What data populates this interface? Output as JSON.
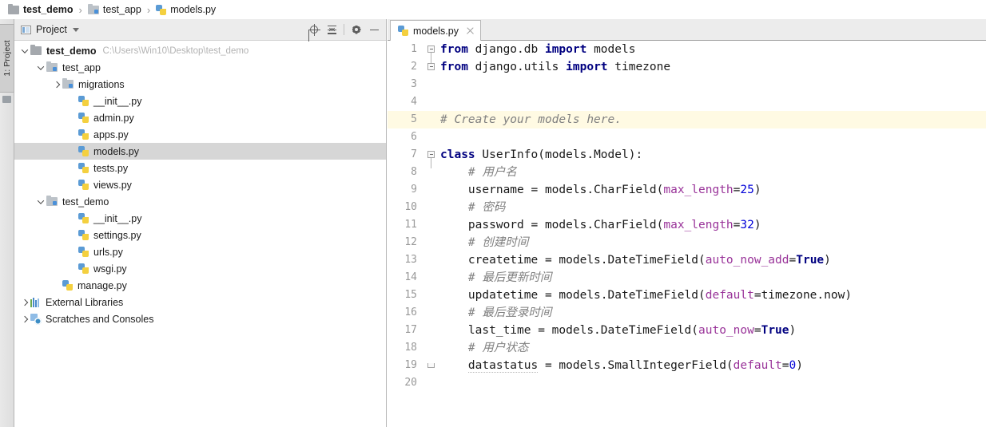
{
  "breadcrumb": {
    "items": [
      {
        "label": "test_demo",
        "icon": "folder-icon",
        "bold": true
      },
      {
        "label": "test_app",
        "icon": "folder-icon",
        "bold": false
      },
      {
        "label": "models.py",
        "icon": "python-file-icon",
        "bold": false
      }
    ],
    "separator": "›"
  },
  "tool_strip": {
    "tab_label": "1: Project"
  },
  "project_panel": {
    "title": "Project",
    "actions": [
      {
        "name": "locate-in-tree-button",
        "icon": "crosshair-icon"
      },
      {
        "name": "collapse-all-button",
        "icon": "collapse-all-icon"
      },
      {
        "name": "panel-settings-button",
        "icon": "gear-icon"
      },
      {
        "name": "hide-panel-button",
        "icon": "minimize-icon"
      }
    ],
    "tree": [
      {
        "label": "test_demo",
        "sub": "C:\\Users\\Win10\\Desktop\\test_demo",
        "icon": "folder-icon",
        "arrow": "down",
        "indent": 0,
        "bold": true,
        "selected": false
      },
      {
        "label": "test_app",
        "sub": "",
        "icon": "folder-blue-icon",
        "arrow": "down",
        "indent": 1,
        "bold": false,
        "selected": false
      },
      {
        "label": "migrations",
        "sub": "",
        "icon": "folder-blue-icon",
        "arrow": "right",
        "indent": 2,
        "bold": false,
        "selected": false
      },
      {
        "label": "__init__.py",
        "sub": "",
        "icon": "python-file-icon",
        "arrow": "none",
        "indent": 3,
        "bold": false,
        "selected": false
      },
      {
        "label": "admin.py",
        "sub": "",
        "icon": "python-file-icon",
        "arrow": "none",
        "indent": 3,
        "bold": false,
        "selected": false
      },
      {
        "label": "apps.py",
        "sub": "",
        "icon": "python-file-icon",
        "arrow": "none",
        "indent": 3,
        "bold": false,
        "selected": false
      },
      {
        "label": "models.py",
        "sub": "",
        "icon": "python-file-icon",
        "arrow": "none",
        "indent": 3,
        "bold": false,
        "selected": true
      },
      {
        "label": "tests.py",
        "sub": "",
        "icon": "python-file-icon",
        "arrow": "none",
        "indent": 3,
        "bold": false,
        "selected": false
      },
      {
        "label": "views.py",
        "sub": "",
        "icon": "python-file-icon",
        "arrow": "none",
        "indent": 3,
        "bold": false,
        "selected": false
      },
      {
        "label": "test_demo",
        "sub": "",
        "icon": "folder-blue-icon",
        "arrow": "down",
        "indent": 1,
        "bold": false,
        "selected": false
      },
      {
        "label": "__init__.py",
        "sub": "",
        "icon": "python-file-icon",
        "arrow": "none",
        "indent": 3,
        "bold": false,
        "selected": false
      },
      {
        "label": "settings.py",
        "sub": "",
        "icon": "python-file-icon",
        "arrow": "none",
        "indent": 3,
        "bold": false,
        "selected": false
      },
      {
        "label": "urls.py",
        "sub": "",
        "icon": "python-file-icon",
        "arrow": "none",
        "indent": 3,
        "bold": false,
        "selected": false
      },
      {
        "label": "wsgi.py",
        "sub": "",
        "icon": "python-file-icon",
        "arrow": "none",
        "indent": 3,
        "bold": false,
        "selected": false
      },
      {
        "label": "manage.py",
        "sub": "",
        "icon": "python-file-icon",
        "arrow": "none",
        "indent": 2,
        "bold": false,
        "selected": false
      },
      {
        "label": "External Libraries",
        "sub": "",
        "icon": "library-icon",
        "arrow": "right",
        "indent": 0,
        "bold": false,
        "selected": false
      },
      {
        "label": "Scratches and Consoles",
        "sub": "",
        "icon": "scratches-icon",
        "arrow": "right",
        "indent": 0,
        "bold": false,
        "selected": false
      }
    ]
  },
  "editor": {
    "tabs": [
      {
        "label": "models.py",
        "icon": "python-file-icon",
        "active": true,
        "close_label": "×"
      }
    ],
    "lines": [
      {
        "num": "1",
        "fold": "start",
        "current": false,
        "tokens": [
          {
            "t": "from ",
            "c": "t-kw"
          },
          {
            "t": "django.db ",
            "c": "t-plain"
          },
          {
            "t": "import ",
            "c": "t-kw"
          },
          {
            "t": "models",
            "c": "t-plain"
          }
        ]
      },
      {
        "num": "2",
        "fold": "end",
        "current": false,
        "tokens": [
          {
            "t": "from ",
            "c": "t-kw"
          },
          {
            "t": "django.utils ",
            "c": "t-plain"
          },
          {
            "t": "import ",
            "c": "t-kw"
          },
          {
            "t": "timezone",
            "c": "t-plain"
          }
        ]
      },
      {
        "num": "3",
        "fold": "none",
        "current": false,
        "tokens": []
      },
      {
        "num": "4",
        "fold": "none",
        "current": false,
        "tokens": []
      },
      {
        "num": "5",
        "fold": "none",
        "current": true,
        "tokens": [
          {
            "t": "# Create your models here.",
            "c": "t-cmt"
          }
        ]
      },
      {
        "num": "6",
        "fold": "none",
        "current": false,
        "tokens": []
      },
      {
        "num": "7",
        "fold": "start",
        "current": false,
        "tokens": [
          {
            "t": "class ",
            "c": "t-kw"
          },
          {
            "t": "UserInfo(models.Model):",
            "c": "t-plain"
          }
        ]
      },
      {
        "num": "8",
        "fold": "none",
        "current": false,
        "tokens": [
          {
            "t": "    # 用户名",
            "c": "t-cmt"
          }
        ]
      },
      {
        "num": "9",
        "fold": "none",
        "current": false,
        "tokens": [
          {
            "t": "    username = models.CharField(",
            "c": "t-plain"
          },
          {
            "t": "max_length",
            "c": "t-kwarg"
          },
          {
            "t": "=",
            "c": "t-plain"
          },
          {
            "t": "25",
            "c": "t-num"
          },
          {
            "t": ")",
            "c": "t-plain"
          }
        ]
      },
      {
        "num": "10",
        "fold": "none",
        "current": false,
        "tokens": [
          {
            "t": "    # 密码",
            "c": "t-cmt"
          }
        ]
      },
      {
        "num": "11",
        "fold": "none",
        "current": false,
        "tokens": [
          {
            "t": "    password = models.CharField(",
            "c": "t-plain"
          },
          {
            "t": "max_length",
            "c": "t-kwarg"
          },
          {
            "t": "=",
            "c": "t-plain"
          },
          {
            "t": "32",
            "c": "t-num"
          },
          {
            "t": ")",
            "c": "t-plain"
          }
        ]
      },
      {
        "num": "12",
        "fold": "none",
        "current": false,
        "tokens": [
          {
            "t": "    # 创建时间",
            "c": "t-cmt"
          }
        ]
      },
      {
        "num": "13",
        "fold": "none",
        "current": false,
        "tokens": [
          {
            "t": "    createtime = models.DateTimeField(",
            "c": "t-plain"
          },
          {
            "t": "auto_now_add",
            "c": "t-kwarg"
          },
          {
            "t": "=",
            "c": "t-plain"
          },
          {
            "t": "True",
            "c": "t-bool"
          },
          {
            "t": ")",
            "c": "t-plain"
          }
        ]
      },
      {
        "num": "14",
        "fold": "none",
        "current": false,
        "tokens": [
          {
            "t": "    # 最后更新时间",
            "c": "t-cmt"
          }
        ]
      },
      {
        "num": "15",
        "fold": "none",
        "current": false,
        "tokens": [
          {
            "t": "    updatetime = models.DateTimeField(",
            "c": "t-plain"
          },
          {
            "t": "default",
            "c": "t-kwarg"
          },
          {
            "t": "=timezone.now)",
            "c": "t-plain"
          }
        ]
      },
      {
        "num": "16",
        "fold": "none",
        "current": false,
        "tokens": [
          {
            "t": "    # 最后登录时间",
            "c": "t-cmt"
          }
        ]
      },
      {
        "num": "17",
        "fold": "none",
        "current": false,
        "tokens": [
          {
            "t": "    last_time = models.DateTimeField(",
            "c": "t-plain"
          },
          {
            "t": "auto_now",
            "c": "t-kwarg"
          },
          {
            "t": "=",
            "c": "t-plain"
          },
          {
            "t": "True",
            "c": "t-bool"
          },
          {
            "t": ")",
            "c": "t-plain"
          }
        ]
      },
      {
        "num": "18",
        "fold": "none",
        "current": false,
        "tokens": [
          {
            "t": "    # 用户状态",
            "c": "t-cmt"
          }
        ]
      },
      {
        "num": "19",
        "fold": "classend",
        "current": false,
        "tokens": [
          {
            "t": "    ",
            "c": "t-plain"
          },
          {
            "t": "datastatus",
            "c": "t-plain squiggle"
          },
          {
            "t": " = models.SmallIntegerField(",
            "c": "t-plain"
          },
          {
            "t": "default",
            "c": "t-kwarg"
          },
          {
            "t": "=",
            "c": "t-plain"
          },
          {
            "t": "0",
            "c": "t-num"
          },
          {
            "t": ")",
            "c": "t-plain"
          }
        ]
      },
      {
        "num": "20",
        "fold": "none",
        "current": false,
        "tokens": []
      }
    ]
  },
  "colors": {
    "keyword": "#000080",
    "comment": "#808080",
    "kwarg": "#993399",
    "number": "#0000d8",
    "current_line_bg": "#fffae3",
    "selection_bg": "#d6d6d6",
    "panel_bg": "#ececec"
  }
}
